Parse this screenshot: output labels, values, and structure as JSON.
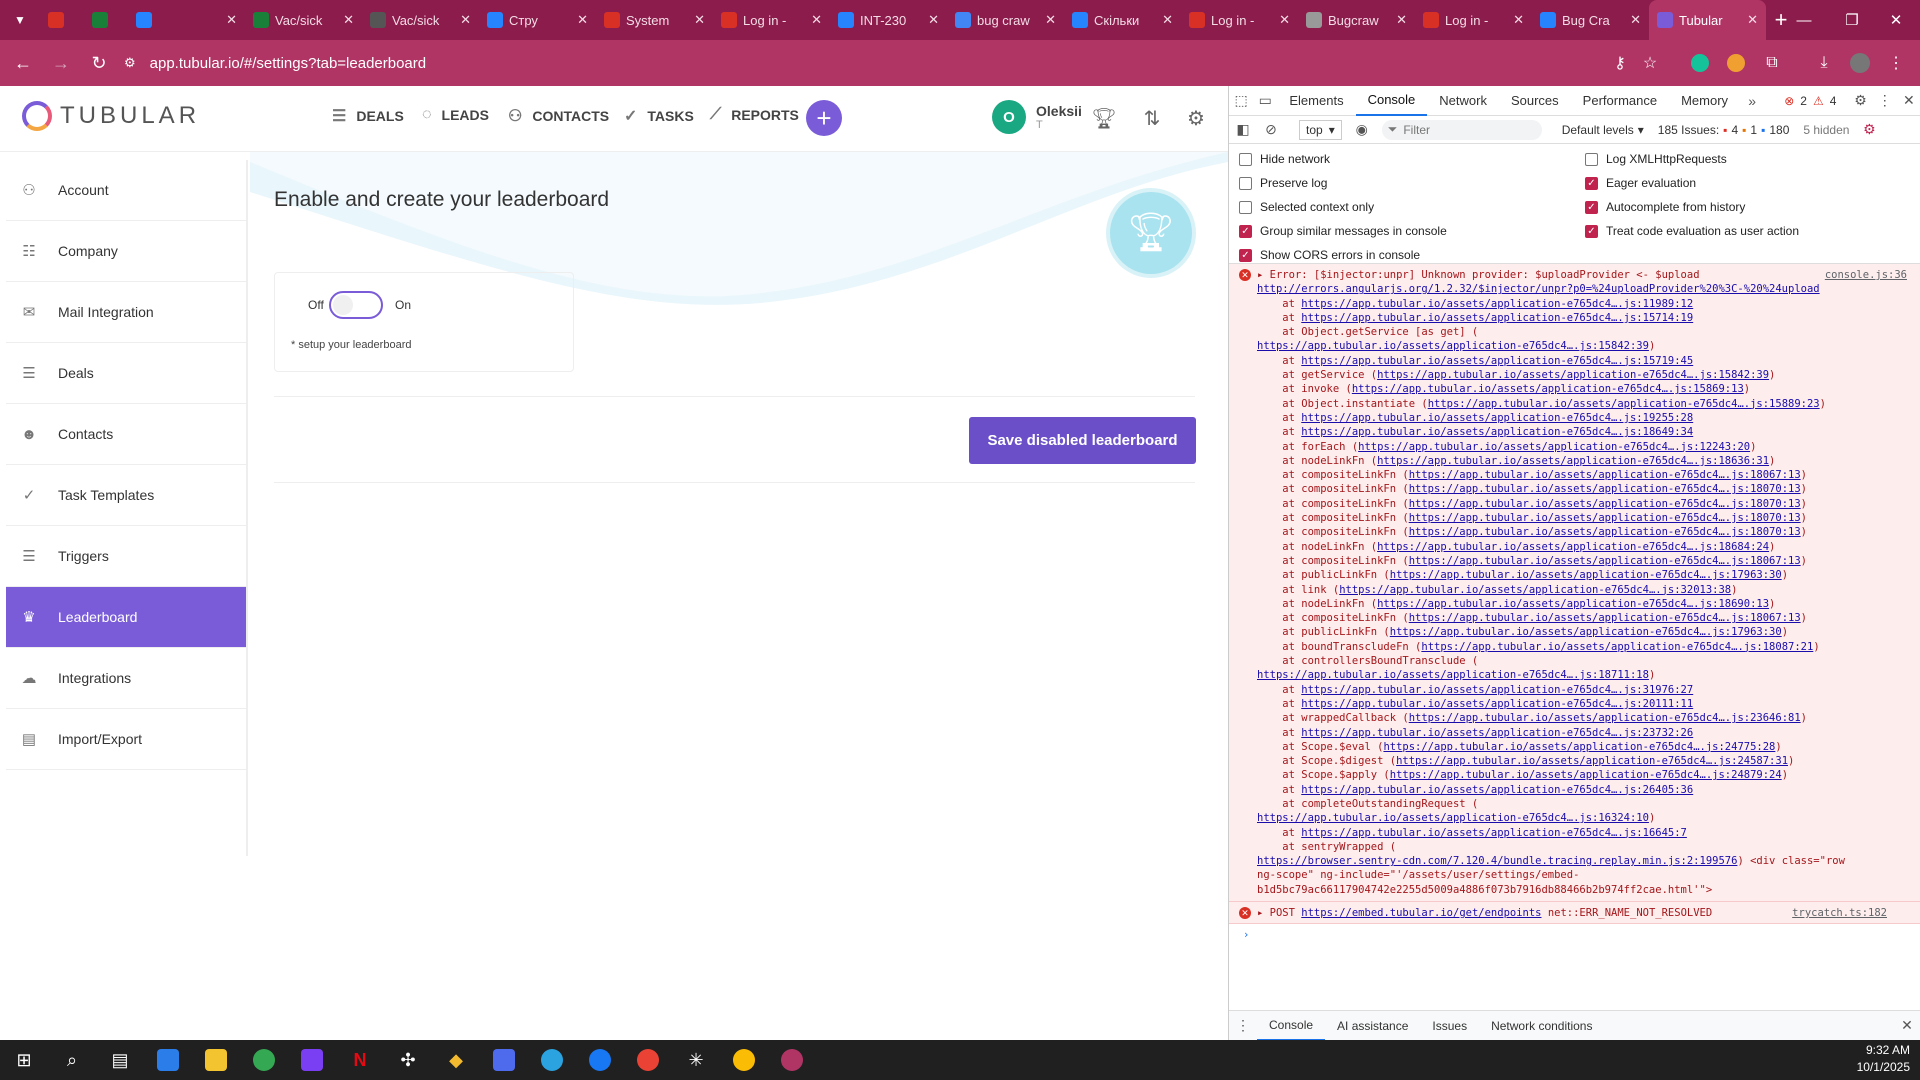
{
  "browser": {
    "tabs": [
      {
        "title": "",
        "fav": "#d93025",
        "active": false
      },
      {
        "title": "",
        "fav": "#188038",
        "active": false
      },
      {
        "title": "",
        "fav": "#2684ff",
        "active": false
      },
      {
        "title": "Vac/sick",
        "fav": "#188038",
        "active": false
      },
      {
        "title": "Vac/sick",
        "fav": "#555",
        "active": false
      },
      {
        "title": "Стру",
        "fav": "#2684ff",
        "active": false
      },
      {
        "title": "System",
        "fav": "#d93025",
        "active": false
      },
      {
        "title": "Log in -",
        "fav": "#d93025",
        "active": false
      },
      {
        "title": "INT-230",
        "fav": "#2684ff",
        "active": false
      },
      {
        "title": "bug craw",
        "fav": "#4285f4",
        "active": false
      },
      {
        "title": "Скільки",
        "fav": "#2684ff",
        "active": false
      },
      {
        "title": "Log in -",
        "fav": "#d93025",
        "active": false
      },
      {
        "title": "Bugcraw",
        "fav": "#999",
        "active": false
      },
      {
        "title": "Log in -",
        "fav": "#d93025",
        "active": false
      },
      {
        "title": "Bug Cra",
        "fav": "#2684ff",
        "active": false
      },
      {
        "title": "Tubular",
        "fav": "#7a5cd8",
        "active": true
      }
    ],
    "url": "app.tubular.io/#/settings?tab=leaderboard"
  },
  "app": {
    "logo_text": "TUBULAR",
    "nav": {
      "deals": "DEALS",
      "leads": "LEADS",
      "contacts": "CONTACTS",
      "tasks": "TASKS",
      "reports": "REPORTS"
    },
    "user": {
      "initial": "O",
      "name": "Oleksii",
      "sub": "T"
    },
    "sidebar": [
      {
        "label": "Account",
        "icon": "user-icon"
      },
      {
        "label": "Company",
        "icon": "building-icon"
      },
      {
        "label": "Mail Integration",
        "icon": "mail-icon"
      },
      {
        "label": "Deals",
        "icon": "deals-icon"
      },
      {
        "label": "Contacts",
        "icon": "contacts-icon"
      },
      {
        "label": "Task Templates",
        "icon": "check-icon"
      },
      {
        "label": "Triggers",
        "icon": "list-icon"
      },
      {
        "label": "Leaderboard",
        "icon": "trophy-icon",
        "active": true
      },
      {
        "label": "Integrations",
        "icon": "cloud-icon"
      },
      {
        "label": "Import/Export",
        "icon": "import-icon"
      }
    ],
    "content": {
      "title": "Enable and create your leaderboard",
      "toggle_off": "Off",
      "toggle_on": "On",
      "hint": "* setup your leaderboard",
      "save_label": "Save disabled leaderboard"
    },
    "accent": "#7a5cd8"
  },
  "devtools": {
    "tabs": [
      "Elements",
      "Console",
      "Network",
      "Sources",
      "Performance",
      "Memory"
    ],
    "active_tab": "Console",
    "err_count": "2",
    "warn_count": "4",
    "context": "top",
    "filter_placeholder": "Filter",
    "levels": "Default levels",
    "issues": "185 Issues:",
    "issues_err": "4",
    "issues_warn": "1",
    "issues_info": "180",
    "hidden": "5 hidden",
    "settings_left": [
      {
        "label": "Hide network",
        "checked": false
      },
      {
        "label": "Preserve log",
        "checked": false
      },
      {
        "label": "Selected context only",
        "checked": false
      },
      {
        "label": "Group similar messages in console",
        "checked": true
      },
      {
        "label": "Show CORS errors in console",
        "checked": true
      }
    ],
    "settings_right": [
      {
        "label": "Log XMLHttpRequests",
        "checked": false
      },
      {
        "label": "Eager evaluation",
        "checked": true
      },
      {
        "label": "Autocomplete from history",
        "checked": true
      },
      {
        "label": "Treat code evaluation as user action",
        "checked": true
      }
    ],
    "error_head": "Error: [$injector:unpr] Unknown provider: $uploadProvider <- $upload",
    "error_src": "console.js:36",
    "error_link": "http://errors.angularjs.org/1.2.32/$injector/unpr?p0=%24uploadProvider%20%3C-%20%24upload",
    "trace": [
      [
        "    at ",
        "https://app.tubular.io/assets/application-e765dc4….js:11989:12",
        ""
      ],
      [
        "    at ",
        "https://app.tubular.io/assets/application-e765dc4….js:15714:19",
        ""
      ],
      [
        "    at Object.getService [as get] (",
        "",
        ""
      ],
      [
        "",
        "https://app.tubular.io/assets/application-e765dc4….js:15842:39",
        ")"
      ],
      [
        "    at ",
        "https://app.tubular.io/assets/application-e765dc4….js:15719:45",
        ""
      ],
      [
        "    at getService (",
        "https://app.tubular.io/assets/application-e765dc4….js:15842:39",
        ")"
      ],
      [
        "    at invoke (",
        "https://app.tubular.io/assets/application-e765dc4….js:15869:13",
        ")"
      ],
      [
        "    at Object.instantiate (",
        "https://app.tubular.io/assets/application-e765dc4….js:15889:23",
        ")"
      ],
      [
        "    at ",
        "https://app.tubular.io/assets/application-e765dc4….js:19255:28",
        ""
      ],
      [
        "    at ",
        "https://app.tubular.io/assets/application-e765dc4….js:18649:34",
        ""
      ],
      [
        "    at forEach (",
        "https://app.tubular.io/assets/application-e765dc4….js:12243:20",
        ")"
      ],
      [
        "    at nodeLinkFn (",
        "https://app.tubular.io/assets/application-e765dc4….js:18636:31",
        ")"
      ],
      [
        "    at compositeLinkFn (",
        "https://app.tubular.io/assets/application-e765dc4….js:18067:13",
        ")"
      ],
      [
        "    at compositeLinkFn (",
        "https://app.tubular.io/assets/application-e765dc4….js:18070:13",
        ")"
      ],
      [
        "    at compositeLinkFn (",
        "https://app.tubular.io/assets/application-e765dc4….js:18070:13",
        ")"
      ],
      [
        "    at compositeLinkFn (",
        "https://app.tubular.io/assets/application-e765dc4….js:18070:13",
        ")"
      ],
      [
        "    at compositeLinkFn (",
        "https://app.tubular.io/assets/application-e765dc4….js:18070:13",
        ")"
      ],
      [
        "    at nodeLinkFn (",
        "https://app.tubular.io/assets/application-e765dc4….js:18684:24",
        ")"
      ],
      [
        "    at compositeLinkFn (",
        "https://app.tubular.io/assets/application-e765dc4….js:18067:13",
        ")"
      ],
      [
        "    at publicLinkFn (",
        "https://app.tubular.io/assets/application-e765dc4….js:17963:30",
        ")"
      ],
      [
        "    at link (",
        "https://app.tubular.io/assets/application-e765dc4….js:32013:38",
        ")"
      ],
      [
        "    at nodeLinkFn (",
        "https://app.tubular.io/assets/application-e765dc4….js:18690:13",
        ")"
      ],
      [
        "    at compositeLinkFn (",
        "https://app.tubular.io/assets/application-e765dc4….js:18067:13",
        ")"
      ],
      [
        "    at publicLinkFn (",
        "https://app.tubular.io/assets/application-e765dc4….js:17963:30",
        ")"
      ],
      [
        "    at boundTranscludeFn (",
        "https://app.tubular.io/assets/application-e765dc4….js:18087:21",
        ")"
      ],
      [
        "    at controllersBoundTransclude (",
        "",
        ""
      ],
      [
        "",
        "https://app.tubular.io/assets/application-e765dc4….js:18711:18",
        ")"
      ],
      [
        "    at ",
        "https://app.tubular.io/assets/application-e765dc4….js:31976:27",
        ""
      ],
      [
        "    at ",
        "https://app.tubular.io/assets/application-e765dc4….js:20111:11",
        ""
      ],
      [
        "    at wrappedCallback (",
        "https://app.tubular.io/assets/application-e765dc4….js:23646:81",
        ")"
      ],
      [
        "    at ",
        "https://app.tubular.io/assets/application-e765dc4….js:23732:26",
        ""
      ],
      [
        "    at Scope.$eval (",
        "https://app.tubular.io/assets/application-e765dc4….js:24775:28",
        ")"
      ],
      [
        "    at Scope.$digest (",
        "https://app.tubular.io/assets/application-e765dc4….js:24587:31",
        ")"
      ],
      [
        "    at Scope.$apply (",
        "https://app.tubular.io/assets/application-e765dc4….js:24879:24",
        ")"
      ],
      [
        "    at ",
        "https://app.tubular.io/assets/application-e765dc4….js:26405:36",
        ""
      ],
      [
        "    at completeOutstandingRequest (",
        "",
        ""
      ],
      [
        "",
        "https://app.tubular.io/assets/application-e765dc4….js:16324:10",
        ")"
      ],
      [
        "    at ",
        "https://app.tubular.io/assets/application-e765dc4….js:16645:7",
        ""
      ],
      [
        "    at sentryWrapped (",
        "",
        ""
      ],
      [
        "",
        "https://browser.sentry-cdn.com/7.120.4/bundle.tracing.replay.min.js:2:199576",
        ") <div class=\"row"
      ],
      [
        "ng-scope\" ng-include=\"'/assets/user/settings/embed-",
        "",
        ""
      ],
      [
        "b1d5bc79ac66117904742e2255d5009a4886f073b7916db88466b2b974ff2cae.html'\">",
        "",
        ""
      ]
    ],
    "post_method": "POST",
    "post_url": "https://embed.tubular.io/get/endpoints",
    "post_error": "net::ERR_NAME_NOT_RESOLVED",
    "post_src": "trycatch.ts:182",
    "drawer_tabs": [
      "Console",
      "AI assistance",
      "Issues",
      "Network conditions"
    ]
  },
  "taskbar": {
    "time": "9:32 AM",
    "date": "10/1/2025"
  }
}
